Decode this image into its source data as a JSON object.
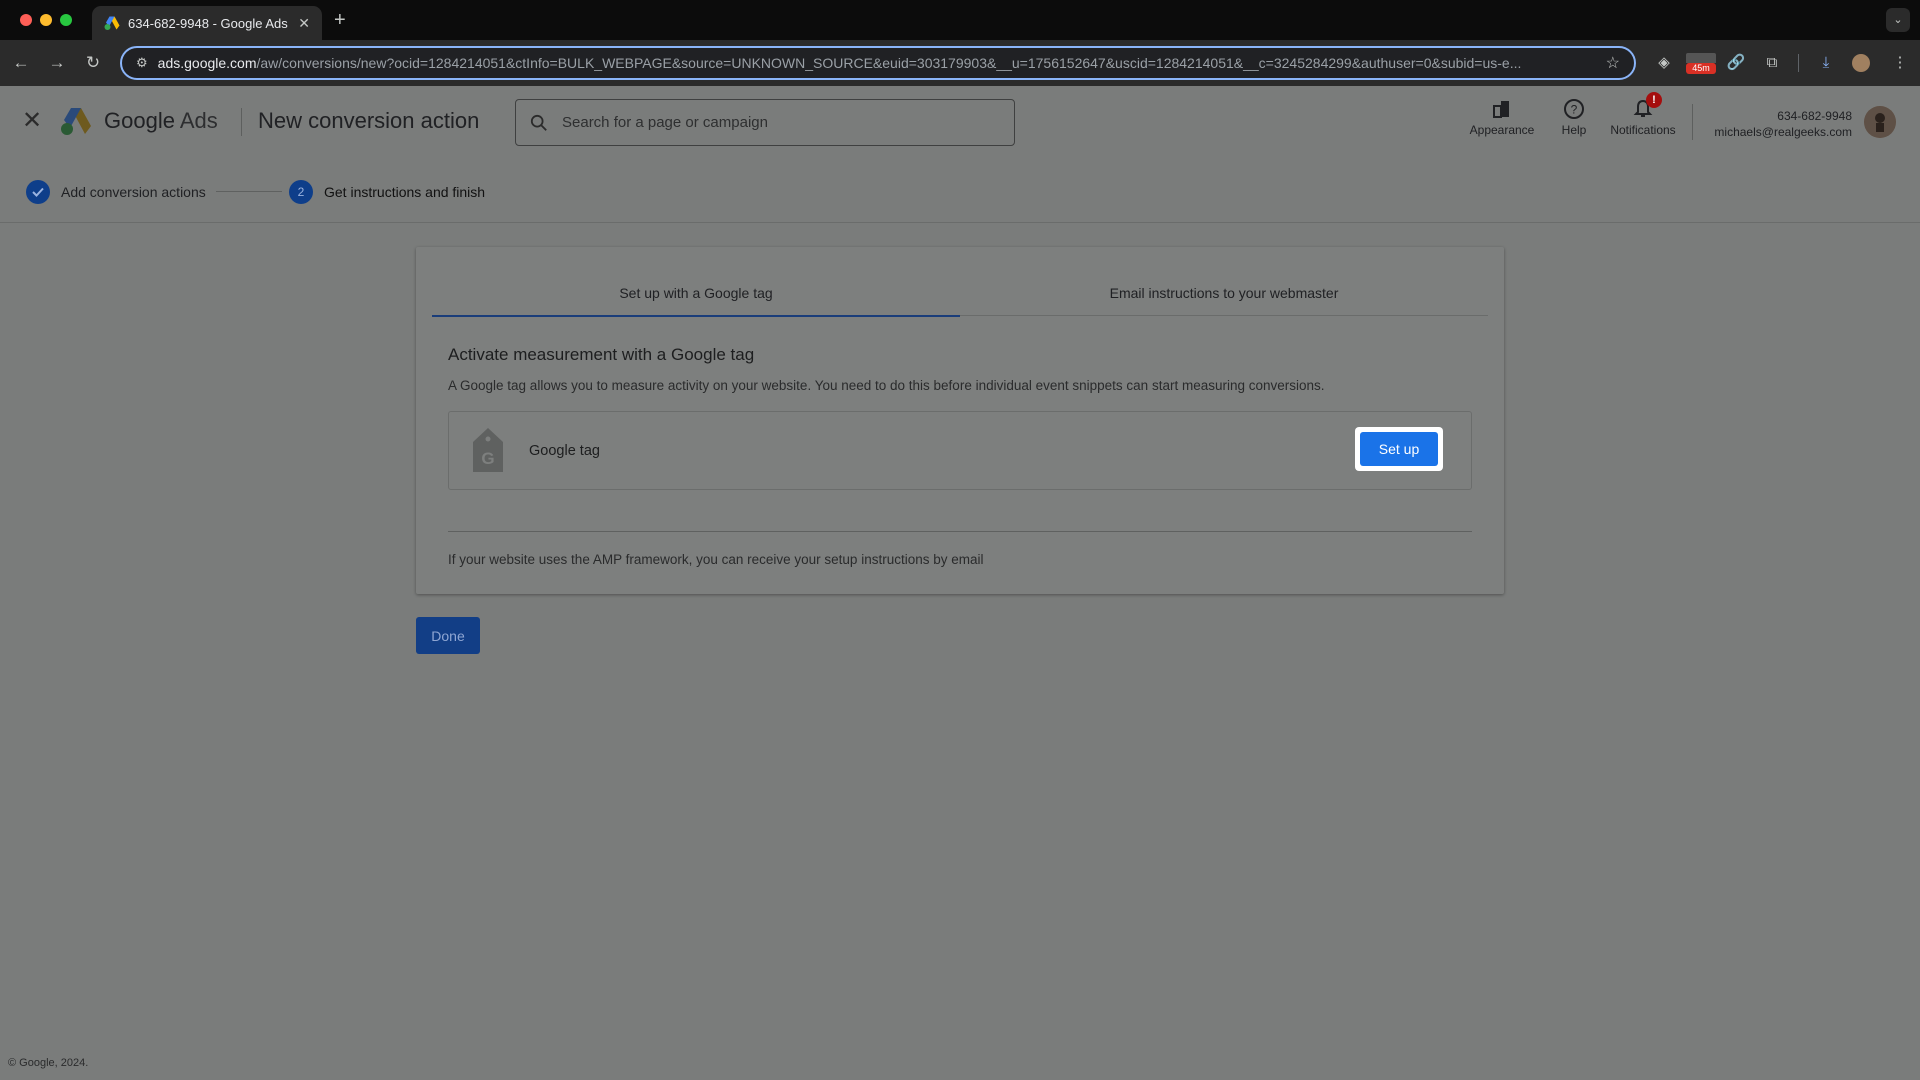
{
  "browser": {
    "tab_title": "634-682-9948 - Google Ads",
    "url_host": "ads.google.com",
    "url_path": "/aw/conversions/new?ocid=1284214051&ctInfo=BULK_WEBPAGE&source=UNKNOWN_SOURCE&euid=303179903&__u=1756152647&uscid=1284214051&__c=3245284299&authuser=0&subid=us-e...",
    "ext_badge": "45m"
  },
  "header": {
    "brand_google": "Google",
    "brand_ads": "Ads",
    "page_title": "New conversion action",
    "search_placeholder": "Search for a page or campaign",
    "actions": {
      "appearance": "Appearance",
      "help": "Help",
      "notifications": "Notifications",
      "notifications_badge": "!"
    },
    "account": {
      "id": "634-682-9948",
      "email": "michaels@realgeeks.com"
    }
  },
  "stepper": {
    "step1_label": "Add conversion actions",
    "step2_number": "2",
    "step2_label": "Get instructions and finish"
  },
  "card": {
    "tabs": [
      "Set up with a Google tag",
      "Email instructions to your webmaster"
    ],
    "heading": "Activate measurement with a Google tag",
    "description": "A Google tag allows you to measure activity on your website. You need to do this before individual event snippets can start measuring conversions.",
    "tag_label": "Google tag",
    "setup_button": "Set up",
    "amp_note": "If your website uses the AMP framework, you can receive your setup instructions by email"
  },
  "done_button": "Done",
  "footer": "© Google, 2024.",
  "colors": {
    "primary_button": "#1a73e8",
    "overlay_bg": "#7a7c7b",
    "done_button": "#123e86"
  }
}
